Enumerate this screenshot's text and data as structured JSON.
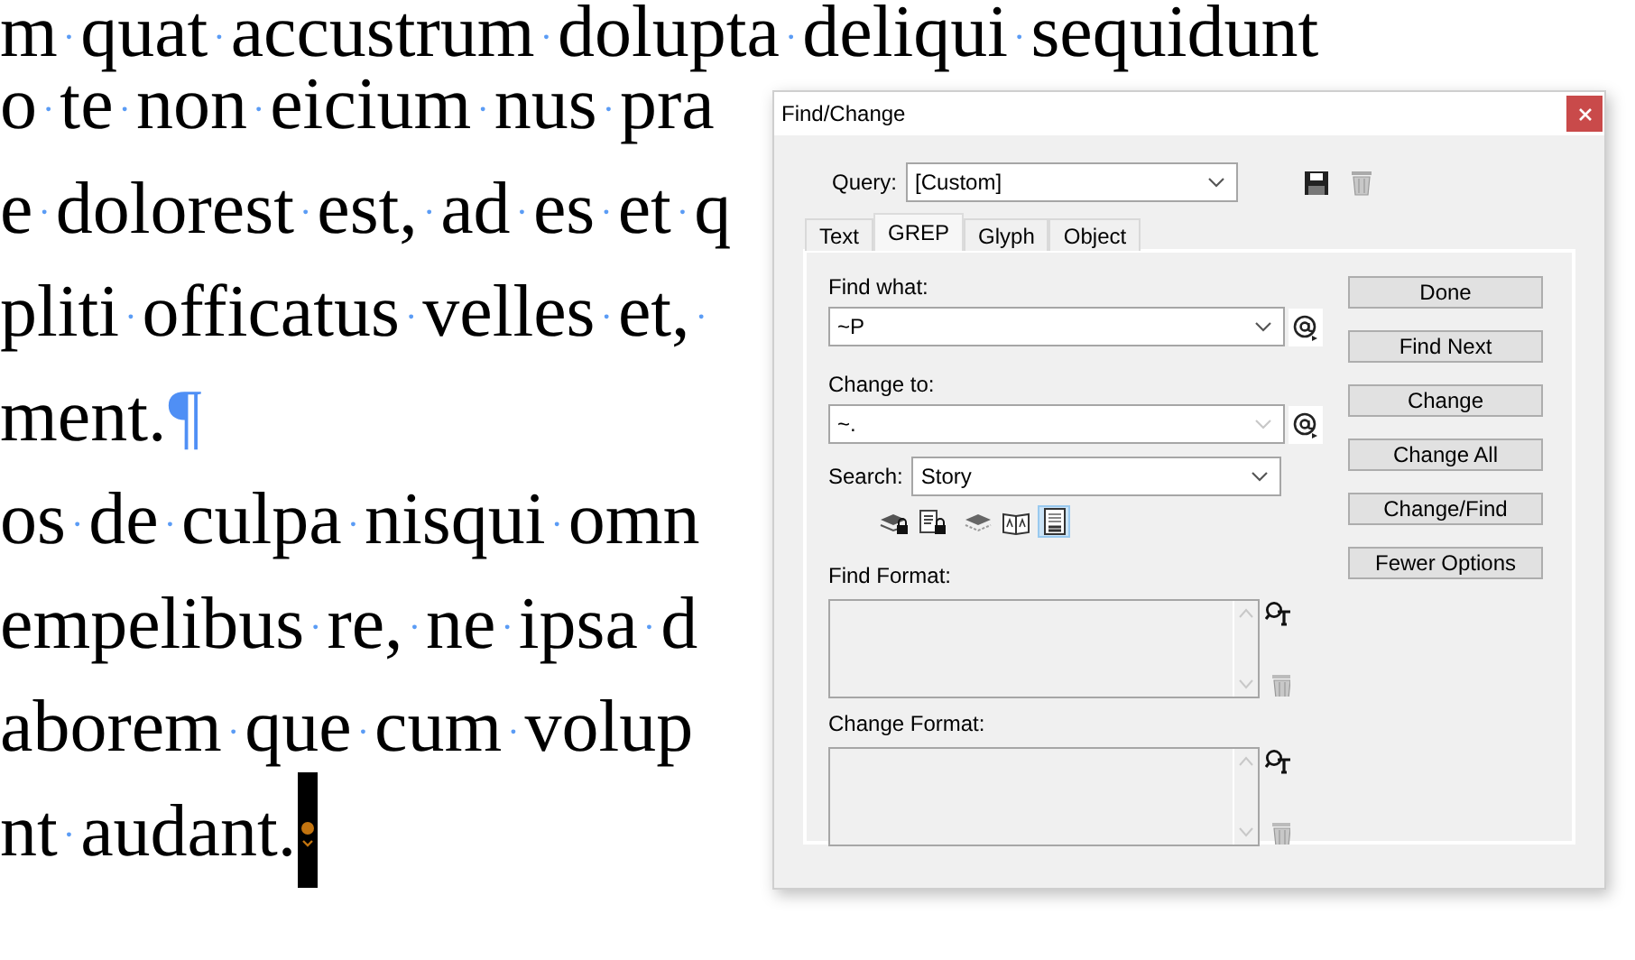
{
  "document": {
    "lines": [
      {
        "text": "m·quat·accustrum·dolupta·deliqui·sequidunt"
      },
      {
        "text": "o·te·non·eicium·nus·pra"
      },
      {
        "text": "e·dolorest·est,·ad·es·et·q"
      },
      {
        "text": "pliti·officatus·velles·et,·"
      },
      {
        "text": "ment.",
        "end_mark": "¶"
      },
      {
        "text": "os·de·culpa·nisqui·omn"
      },
      {
        "text": "empelibus·re,·ne·ipsa·d"
      },
      {
        "text": "aborem·que·cum·volup"
      },
      {
        "text": "nt·audant.",
        "cursor": true
      }
    ]
  },
  "dialog": {
    "title": "Find/Change",
    "query": {
      "label": "Query:",
      "value": "[Custom]"
    },
    "tabs": [
      {
        "label": "Text",
        "selected": false
      },
      {
        "label": "GREP",
        "selected": true
      },
      {
        "label": "Glyph",
        "selected": false
      },
      {
        "label": "Object",
        "selected": false
      }
    ],
    "find_what": {
      "label": "Find what:",
      "value": "~P"
    },
    "change_to": {
      "label": "Change to:",
      "value": "~."
    },
    "search": {
      "label": "Search:",
      "value": "Story"
    },
    "search_options": [
      {
        "kind": "locked-layers",
        "selected": false
      },
      {
        "kind": "locked-stories",
        "selected": false
      },
      {
        "kind": "hidden-layers",
        "selected": false
      },
      {
        "kind": "master-pages",
        "selected": false
      },
      {
        "kind": "footnotes",
        "selected": true
      }
    ],
    "find_format": {
      "label": "Find Format:"
    },
    "change_format": {
      "label": "Change Format:"
    },
    "buttons": [
      "Done",
      "Find Next",
      "Change",
      "Change All",
      "Change/Find",
      "Fewer Options"
    ]
  }
}
